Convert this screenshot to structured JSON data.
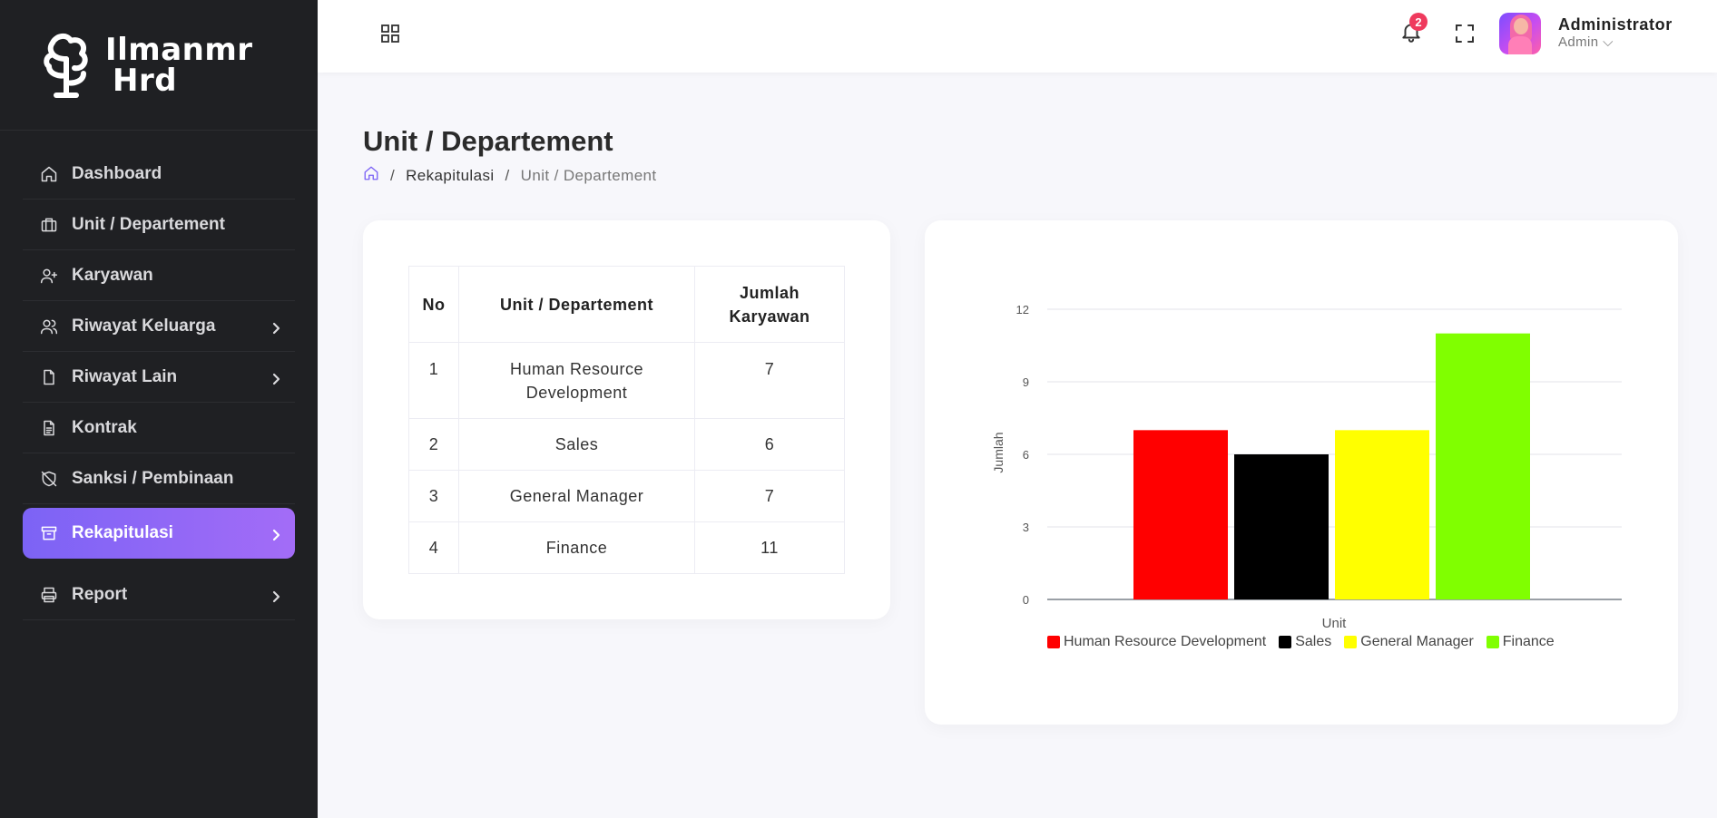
{
  "brand": {
    "line1": "Ilmanmr",
    "line2": "Hrd"
  },
  "sidebar": {
    "items": [
      {
        "label": "Dashboard",
        "icon": "home-icon",
        "has_chevron": false
      },
      {
        "label": "Unit / Departement",
        "icon": "briefcase-icon",
        "has_chevron": false
      },
      {
        "label": "Karyawan",
        "icon": "user-plus-icon",
        "has_chevron": false
      },
      {
        "label": "Riwayat Keluarga",
        "icon": "users-icon",
        "has_chevron": true
      },
      {
        "label": "Riwayat Lain",
        "icon": "file-icon",
        "has_chevron": true
      },
      {
        "label": "Kontrak",
        "icon": "file-text-icon",
        "has_chevron": false
      },
      {
        "label": "Sanksi / Pembinaan",
        "icon": "shield-off-icon",
        "has_chevron": false
      },
      {
        "label": "Rekapitulasi",
        "icon": "archive-icon",
        "has_chevron": true,
        "active": true
      },
      {
        "label": "Report",
        "icon": "printer-icon",
        "has_chevron": true
      }
    ],
    "active_color": "#7c63f5"
  },
  "header": {
    "notification_count": "2",
    "user_name": "Administrator",
    "user_role": "Admin ⌵"
  },
  "page": {
    "title": "Unit / Departement",
    "breadcrumb": {
      "section": "Rekapitulasi",
      "current": "Unit / Departement"
    }
  },
  "table": {
    "headers": {
      "no": "No",
      "unit": "Unit / Departement",
      "jumlah": "Jumlah Karyawan"
    },
    "rows": [
      {
        "no": "1",
        "unit": "Human Resource Development",
        "jumlah": "7"
      },
      {
        "no": "2",
        "unit": "Sales",
        "jumlah": "6"
      },
      {
        "no": "3",
        "unit": "General Manager",
        "jumlah": "7"
      },
      {
        "no": "4",
        "unit": "Finance",
        "jumlah": "11"
      }
    ]
  },
  "chart_data": {
    "type": "bar",
    "xlabel": "Unit",
    "ylabel": "Jumlah",
    "ylim": [
      0,
      12
    ],
    "yticks": [
      "0",
      "3",
      "6",
      "9",
      "12"
    ],
    "grid": true,
    "legend_position": "bottom",
    "series": [
      {
        "name": "Human Resource Development",
        "value": 7,
        "color": "#ff0000"
      },
      {
        "name": "Sales",
        "value": 6,
        "color": "#000000"
      },
      {
        "name": "General Manager",
        "value": 7,
        "color": "#ffff00"
      },
      {
        "name": "Finance",
        "value": 11,
        "color": "#80ff00"
      }
    ]
  }
}
